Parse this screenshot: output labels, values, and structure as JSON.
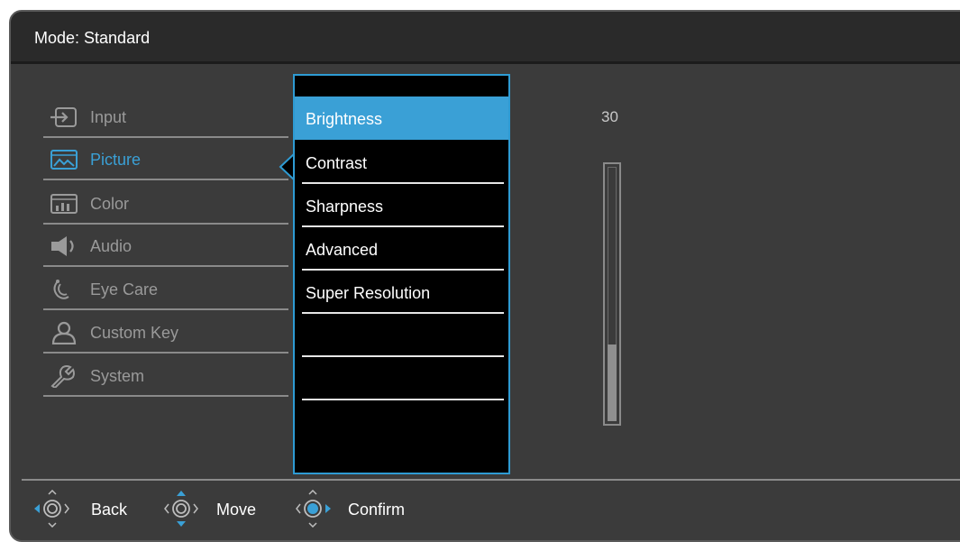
{
  "header": {
    "mode_label": "Mode: Standard"
  },
  "sidebar": {
    "items": [
      {
        "label": "Input",
        "icon": "input-icon",
        "active": false
      },
      {
        "label": "Picture",
        "icon": "picture-icon",
        "active": true
      },
      {
        "label": "Color",
        "icon": "color-icon",
        "active": false
      },
      {
        "label": "Audio",
        "icon": "speaker-icon",
        "active": false
      },
      {
        "label": "Eye Care",
        "icon": "eye-care-icon",
        "active": false
      },
      {
        "label": "Custom Key",
        "icon": "user-icon",
        "active": false
      },
      {
        "label": "System",
        "icon": "wrench-icon",
        "active": false
      }
    ]
  },
  "submenu": {
    "items": [
      {
        "label": "Brightness",
        "selected": true
      },
      {
        "label": "Contrast",
        "selected": false
      },
      {
        "label": "Sharpness",
        "selected": false
      },
      {
        "label": "Advanced",
        "selected": false
      },
      {
        "label": "Super Resolution",
        "selected": false
      },
      {
        "label": "",
        "selected": false
      },
      {
        "label": "",
        "selected": false
      }
    ]
  },
  "slider": {
    "value": "30",
    "level_fraction": 0.3
  },
  "footer": {
    "hints": [
      {
        "label": "Back",
        "icon": "joystick-left-icon"
      },
      {
        "label": "Move",
        "icon": "joystick-up-down-icon"
      },
      {
        "label": "Confirm",
        "icon": "joystick-press-icon"
      }
    ]
  },
  "colors": {
    "accent": "#3aa0d6",
    "panel": "#3b3b3b",
    "header": "#2a2a2a",
    "submenu_bg": "#000000",
    "inactive_text": "#9a9a9a"
  }
}
